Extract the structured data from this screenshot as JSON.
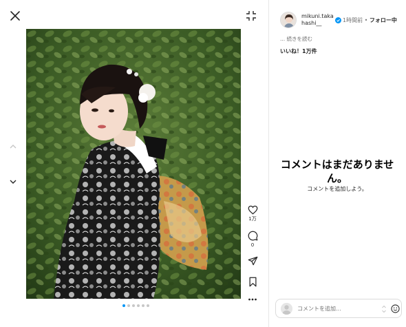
{
  "post": {
    "username": "mikuni.takahashi__",
    "time": "1時間前",
    "separator": " • ",
    "follow_status": "フォロー中",
    "read_more": "... 続きを読む",
    "likes": "いいね！1万件",
    "like_count": "1万",
    "comment_count": "0",
    "verified": true,
    "slide_count": 6,
    "active_slide": 1
  },
  "comments": {
    "empty_title": "コメントはまだありません。",
    "empty_subtitle": "コメントを追加しよう。",
    "input_placeholder": "コメントを追加..."
  },
  "icons": {
    "close": "close-icon",
    "collapse": "collapse-icon",
    "prev": "chevron-up-icon",
    "next_post": "chevron-down-icon",
    "next_image": "chevron-right-icon",
    "like": "heart-icon",
    "comment": "comment-icon",
    "share": "send-icon",
    "save": "bookmark-icon",
    "more": "more-icon",
    "emoji": "emoji-icon"
  },
  "colors": {
    "accent": "#0095f6",
    "muted": "#737373",
    "border": "#dbdbdb"
  }
}
